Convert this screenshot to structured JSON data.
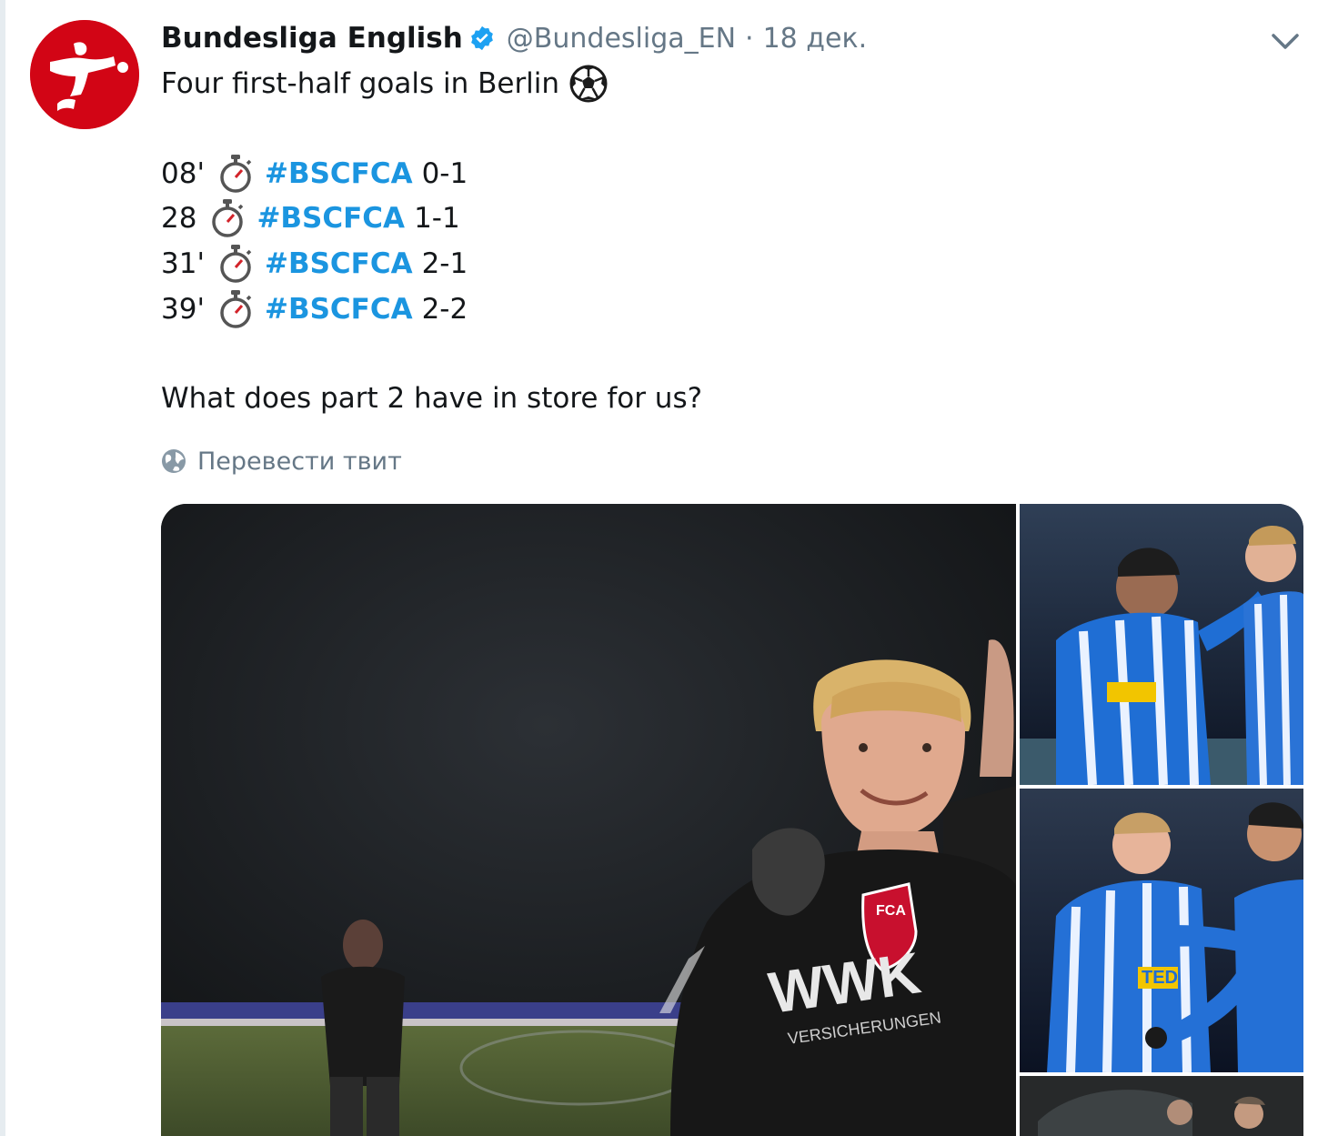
{
  "tweet": {
    "author": {
      "display_name": "Bundesliga English",
      "verified": true,
      "handle": "@Bundesliga_EN",
      "separator": "·",
      "date": "18 дек."
    },
    "lines": {
      "intro": "Four first-half goals in Berlin",
      "goals": [
        {
          "minute": "08'",
          "hashtag": "#BSCFCA",
          "score": "0-1"
        },
        {
          "minute": "28",
          "hashtag": "#BSCFCA",
          "score": "1-1"
        },
        {
          "minute": "31'",
          "hashtag": "#BSCFCA",
          "score": "2-1"
        },
        {
          "minute": "39'",
          "hashtag": "#BSCFCA",
          "score": "2-2"
        }
      ],
      "outro": "What does part 2 have in store for us?"
    },
    "translate_label": "Перевести твит",
    "media": {
      "main_shirt_text": "WWK",
      "main_shirt_subtext": "VERSICHERUNGEN",
      "main_badge_text": "FCA",
      "r2_shirt_text": "TED"
    }
  },
  "icons": [
    "bundesliga-logo-icon",
    "verified-badge-icon",
    "chevron-down-icon",
    "soccer-ball-icon",
    "stopwatch-icon",
    "globe-icon"
  ],
  "colors": {
    "accent": "#1b95e0",
    "brand_red": "#d20515",
    "muted": "#657786",
    "text": "#14171a"
  }
}
